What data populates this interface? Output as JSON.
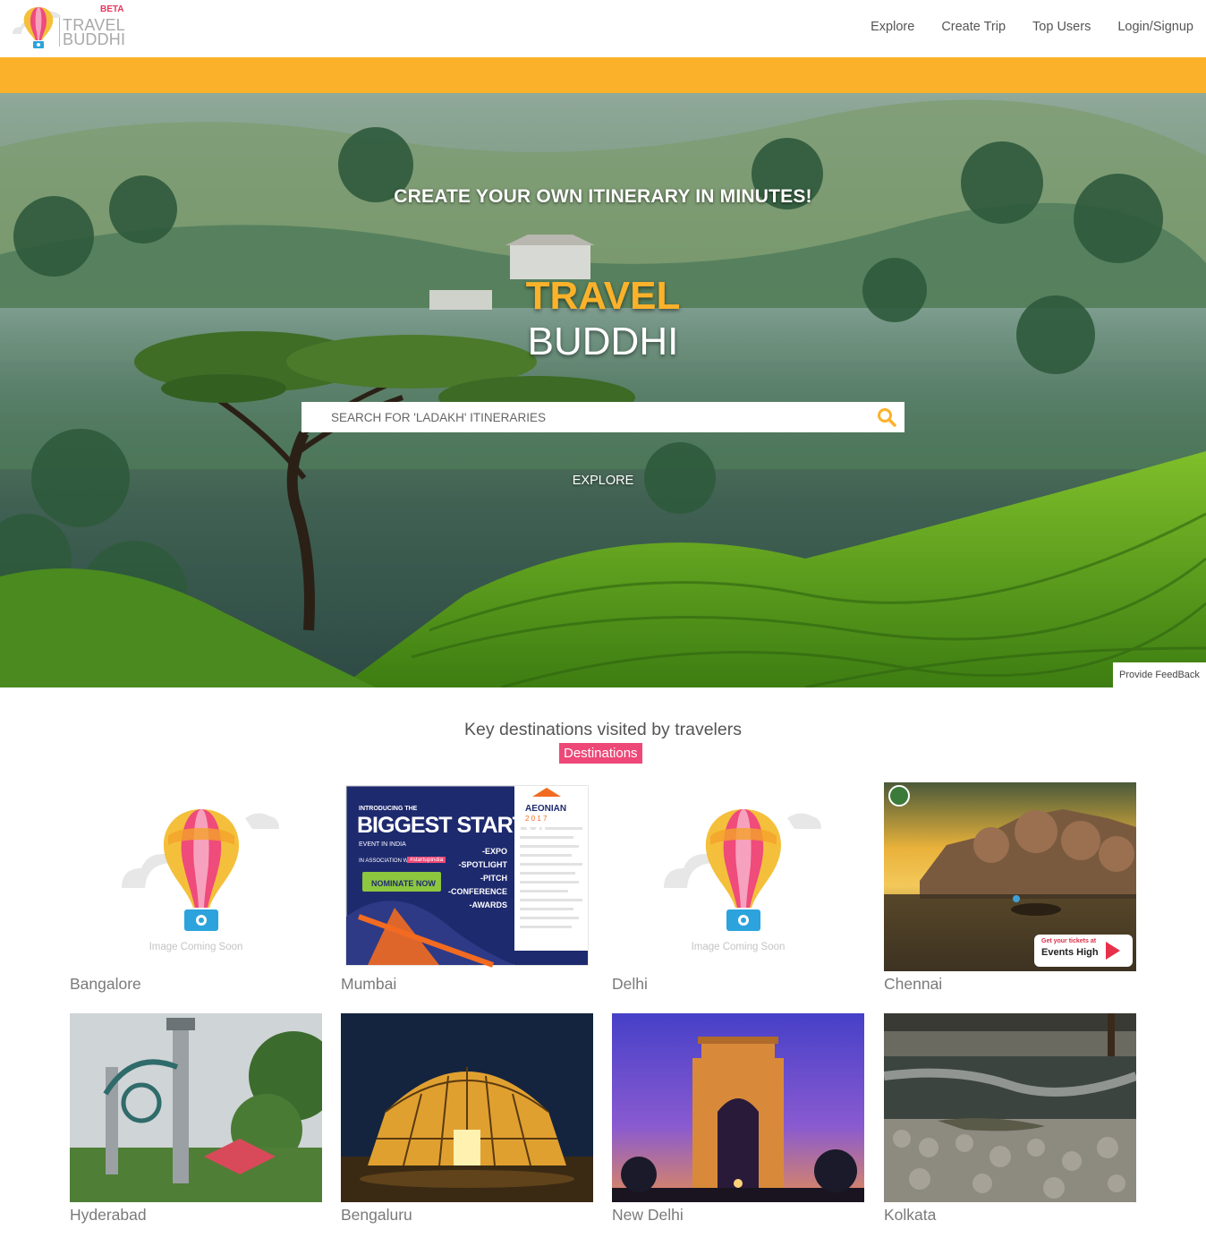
{
  "header": {
    "logo": {
      "beta": "BETA",
      "word1": "TRAVEL",
      "word2": "BUDDHI"
    },
    "nav": [
      {
        "label": "Explore"
      },
      {
        "label": "Create Trip"
      },
      {
        "label": "Top Users"
      },
      {
        "label": "Login/Signup"
      }
    ]
  },
  "colors": {
    "accent": "#fbb22a",
    "badge": "#ee4878"
  },
  "hero": {
    "tagline": "CREATE YOUR OWN ITINERARY IN MINUTES!",
    "brand_line1": "TRAVEL",
    "brand_line2": "BUDDHI",
    "search_placeholder": "SEARCH FOR 'LADAKH' ITINERARIES",
    "explore": "EXPLORE",
    "feedback": "Provide FeedBack"
  },
  "destinations": {
    "title": "Key destinations visited by travelers",
    "badge": "Destinations",
    "placeholder_caption": "Image Coming Soon",
    "promo": {
      "intro": "INTRODUCING THE",
      "headline": "BIGGEST STARTUP",
      "sub": "EVENT IN INDIA",
      "assoc": "IN ASSOCIATION WITH",
      "tag": "#startupindia",
      "cta": "NOMINATE NOW",
      "items": [
        "-EXPO",
        "-SPOTLIGHT",
        "-PITCH",
        "-CONFERENCE",
        "-AWARDS"
      ],
      "brand": "AEONIAN",
      "year": "2 0 1 7"
    },
    "events_badge": {
      "line1": "Get your tickets at",
      "line2": "Events High"
    },
    "items": [
      {
        "name": "Bangalore",
        "image": "placeholder"
      },
      {
        "name": "Mumbai",
        "image": "startup-event-poster"
      },
      {
        "name": "Delhi",
        "image": "placeholder"
      },
      {
        "name": "Chennai",
        "image": "river-rocks-sunset"
      },
      {
        "name": "Hyderabad",
        "image": "monument-towers"
      },
      {
        "name": "Bengaluru",
        "image": "glass-house-night"
      },
      {
        "name": "New Delhi",
        "image": "india-gate-dusk"
      },
      {
        "name": "Kolkata",
        "image": "crocodile-pond"
      }
    ]
  }
}
